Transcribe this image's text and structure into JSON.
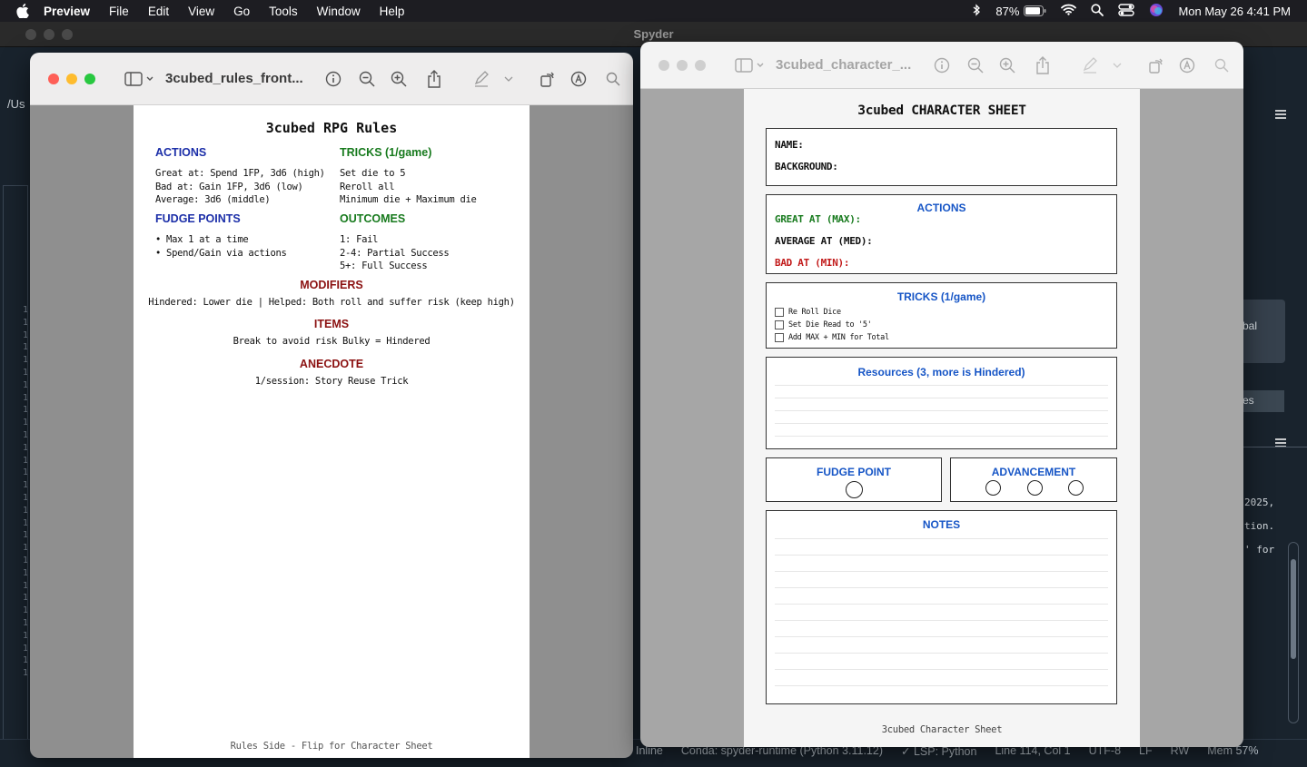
{
  "menubar": {
    "app": "Preview",
    "items": [
      "File",
      "Edit",
      "View",
      "Go",
      "Tools",
      "Window",
      "Help"
    ],
    "battery": "87%",
    "clock": "Mon May 26  4:41 PM"
  },
  "spyder": {
    "title": "Spyder",
    "path": "/Us",
    "line_numbers": [
      "1",
      "1",
      "1",
      "1",
      "1",
      "1",
      "1",
      "1",
      "1",
      "1",
      "1",
      "1",
      "1",
      "1",
      "1",
      "1",
      "1",
      "1",
      "1",
      "1",
      "1",
      "1",
      "1",
      "1",
      "1",
      "1",
      "1",
      "1",
      "1",
      "1"
    ],
    "global_label": "bal",
    "tab_label": "es",
    "console_lines": [
      "2025,",
      "tion.",
      "' for"
    ],
    "status": {
      "inline": "Inline",
      "conda": "Conda: spyder-runtime (Python 3.11.12)",
      "lsp": "✓ LSP: Python",
      "position": "Line 114, Col 1",
      "encoding": "UTF-8",
      "eol": "LF",
      "rw": "RW",
      "mem": "Mem 57%"
    }
  },
  "preview_front": {
    "title": "3cubed_rules_front...",
    "page": {
      "title": "3cubed RPG Rules",
      "actions_heading": "ACTIONS",
      "actions_lines": [
        "Great at: Spend 1FP, 3d6 (high)",
        "Bad at: Gain 1FP, 3d6 (low)",
        "Average: 3d6 (middle)"
      ],
      "tricks_heading": "TRICKS (1/game)",
      "tricks_lines": [
        "Set die to 5",
        "Reroll all",
        "Minimum die + Maximum die"
      ],
      "fudge_heading": "FUDGE POINTS",
      "fudge_lines": [
        "• Max 1 at a time",
        "• Spend/Gain via actions"
      ],
      "outcomes_heading": "OUTCOMES",
      "outcomes_lines": [
        "1: Fail",
        "2-4: Partial Success",
        "5+: Full Success"
      ],
      "modifiers_heading": "MODIFIERS",
      "modifiers_text": "Hindered: Lower die | Helped: Both roll and suffer risk (keep high)",
      "items_heading": "ITEMS",
      "items_text": "Break to avoid risk  Bulky = Hindered",
      "anecdote_heading": "ANECDOTE",
      "anecdote_text": "1/session: Story    Reuse Trick",
      "footer": "Rules Side - Flip for Character Sheet"
    }
  },
  "preview_sheet": {
    "title": "3cubed_character_...",
    "page": {
      "title": "3cubed CHARACTER SHEET",
      "name_label": "NAME:",
      "background_label": "BACKGROUND:",
      "actions_heading": "ACTIONS",
      "great_label": "GREAT AT (MAX):",
      "average_label": "AVERAGE AT (MED):",
      "bad_label": "BAD AT (MIN):",
      "tricks_heading": "TRICKS (1/game)",
      "trick_options": [
        "Re Roll Dice",
        "Set Die Read to '5'",
        "Add MAX + MIN for Total"
      ],
      "resources_heading": "Resources (3, more is Hindered)",
      "fudge_heading": "FUDGE POINT",
      "advancement_heading": "ADVANCEMENT",
      "notes_heading": "NOTES",
      "footer": "3cubed Character Sheet"
    }
  },
  "colors": {
    "blue_heading": "#1b2ea8",
    "green_heading": "#177a1d",
    "red_heading": "#8b1111",
    "sheet_heading": "#1655c6"
  }
}
